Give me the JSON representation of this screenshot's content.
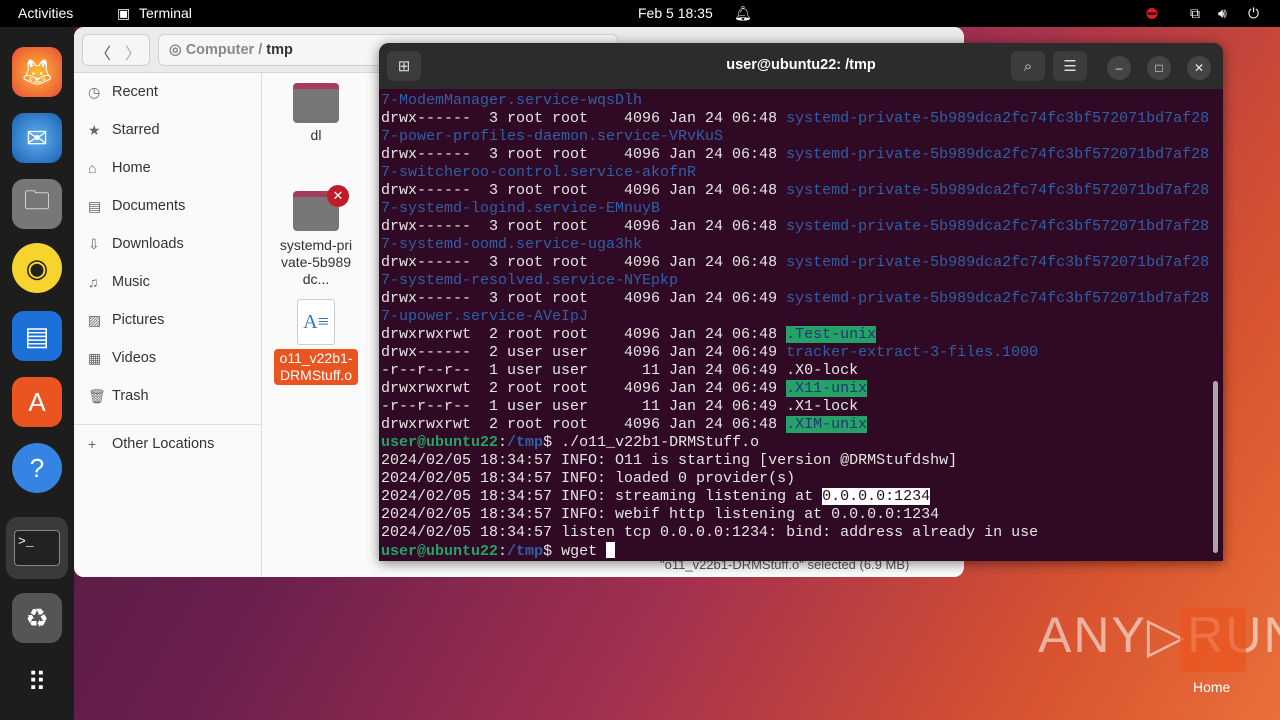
{
  "topbar": {
    "activities": "Activities",
    "app": "Terminal",
    "clock": "Feb 5  18:35"
  },
  "dock": [
    {
      "name": "firefox"
    },
    {
      "name": "thunderbird"
    },
    {
      "name": "files"
    },
    {
      "name": "rhythmbox"
    },
    {
      "name": "writer"
    },
    {
      "name": "app-center"
    },
    {
      "name": "help"
    },
    {
      "name": "terminal"
    },
    {
      "name": "trash"
    },
    {
      "name": "app-grid"
    }
  ],
  "files": {
    "breadcrumb": [
      "Computer",
      "tmp"
    ],
    "sidebar": [
      {
        "label": "Recent",
        "icon": "clock"
      },
      {
        "label": "Starred",
        "icon": "star"
      },
      {
        "label": "Home",
        "icon": "home"
      },
      {
        "label": "Documents",
        "icon": "document"
      },
      {
        "label": "Downloads",
        "icon": "download"
      },
      {
        "label": "Music",
        "icon": "music"
      },
      {
        "label": "Pictures",
        "icon": "picture"
      },
      {
        "label": "Videos",
        "icon": "video"
      },
      {
        "label": "Trash",
        "icon": "trash"
      },
      {
        "label": "Other Locations",
        "icon": "plus"
      }
    ],
    "items": [
      {
        "label": "dl"
      },
      {
        "label": "systemd-private-5b989dc..."
      },
      {
        "label": "o11_v22b1-DRMStuff.o"
      }
    ],
    "status": "\"o11_v22b1-DRMStuff.o\" selected  (6.9 MB)"
  },
  "terminal": {
    "title": "user@ubuntu22: /tmp",
    "lines": [
      [
        [
          "dir",
          "7-ModemManager.service-wqsDlh"
        ]
      ],
      [
        [
          "",
          "drwx------  3 root root    4096 Jan 24 06:48 "
        ],
        [
          "dir",
          "systemd-private-5b989dca2fc74fc3bf572071bd7af28"
        ]
      ],
      [
        [
          "dir",
          "7-power-profiles-daemon.service-VRvKuS"
        ]
      ],
      [
        [
          "",
          "drwx------  3 root root    4096 Jan 24 06:48 "
        ],
        [
          "dir",
          "systemd-private-5b989dca2fc74fc3bf572071bd7af28"
        ]
      ],
      [
        [
          "dir",
          "7-switcheroo-control.service-akofnR"
        ]
      ],
      [
        [
          "",
          "drwx------  3 root root    4096 Jan 24 06:48 "
        ],
        [
          "dir",
          "systemd-private-5b989dca2fc74fc3bf572071bd7af28"
        ]
      ],
      [
        [
          "dir",
          "7-systemd-logind.service-EMnuyB"
        ]
      ],
      [
        [
          "",
          "drwx------  3 root root    4096 Jan 24 06:48 "
        ],
        [
          "dir",
          "systemd-private-5b989dca2fc74fc3bf572071bd7af28"
        ]
      ],
      [
        [
          "dir",
          "7-systemd-oomd.service-uga3hk"
        ]
      ],
      [
        [
          "",
          "drwx------  3 root root    4096 Jan 24 06:48 "
        ],
        [
          "dir",
          "systemd-private-5b989dca2fc74fc3bf572071bd7af28"
        ]
      ],
      [
        [
          "dir",
          "7-systemd-resolved.service-NYEpkp"
        ]
      ],
      [
        [
          "",
          "drwx------  3 root root    4096 Jan 24 06:49 "
        ],
        [
          "dir",
          "systemd-private-5b989dca2fc74fc3bf572071bd7af28"
        ]
      ],
      [
        [
          "dir",
          "7-upower.service-AVeIpJ"
        ]
      ],
      [
        [
          "",
          "drwxrwxrwt  2 root root    4096 Jan 24 06:48 "
        ],
        [
          "hl",
          ".Test-unix"
        ]
      ],
      [
        [
          "",
          "drwx------  2 user user    4096 Jan 24 06:49 "
        ],
        [
          "dir",
          "tracker-extract-3-files.1000"
        ]
      ],
      [
        [
          "",
          "-r--r--r--  1 user user      11 Jan 24 06:49 .X0-lock"
        ]
      ],
      [
        [
          "",
          "drwxrwxrwt  2 root root    4096 Jan 24 06:49 "
        ],
        [
          "hl",
          ".X11-unix"
        ]
      ],
      [
        [
          "",
          "-r--r--r--  1 user user      11 Jan 24 06:49 .X1-lock"
        ]
      ],
      [
        [
          "",
          "drwxrwxrwt  2 root root    4096 Jan 24 06:48 "
        ],
        [
          "hl",
          ".XIM-unix"
        ]
      ],
      [
        [
          "pu",
          "user@ubuntu22"
        ],
        [
          "",
          ":"
        ],
        [
          "pp",
          "/tmp"
        ],
        [
          "",
          "$ ./o11_v22b1-DRMStuff.o"
        ]
      ],
      [
        [
          "",
          "2024/02/05 18:34:57 INFO: O11 is starting [version @DRMStufdshw]"
        ]
      ],
      [
        [
          "",
          "2024/02/05 18:34:57 INFO: loaded 0 provider(s)"
        ]
      ],
      [
        [
          "",
          "2024/02/05 18:34:57 INFO: streaming listening at "
        ],
        [
          "wh",
          "0.0.0.0:1234"
        ]
      ],
      [
        [
          "",
          "2024/02/05 18:34:57 INFO: webif http listening at 0.0.0.0:1234"
        ]
      ],
      [
        [
          "",
          "2024/02/05 18:34:57 listen tcp 0.0.0.0:1234: bind: address already in use"
        ]
      ],
      [
        [
          "pu",
          "user@ubuntu22"
        ],
        [
          "",
          ":"
        ],
        [
          "pp",
          "/tmp"
        ],
        [
          "",
          "$ wget "
        ],
        [
          "cursor",
          ""
        ]
      ]
    ]
  },
  "watermark": {
    "text": "ANY RUN",
    "home_label": "Home"
  }
}
